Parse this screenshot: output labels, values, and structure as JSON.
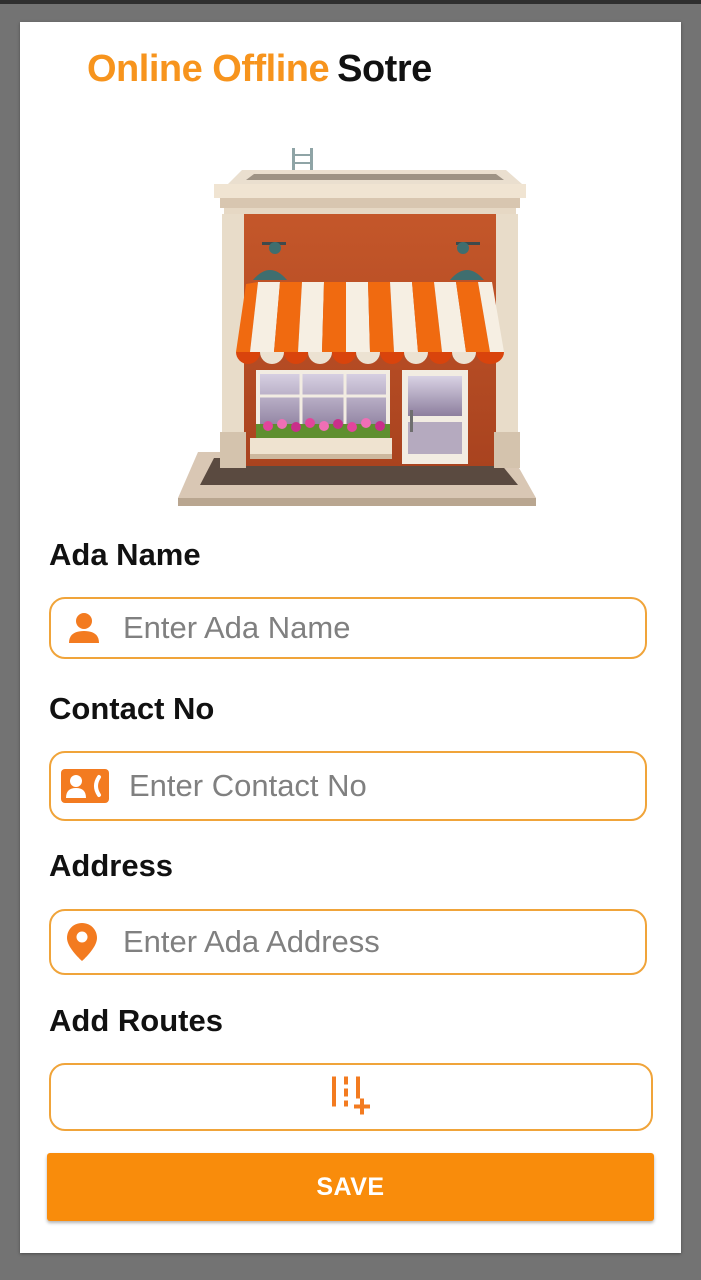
{
  "header": {
    "title_accent": "Online Offline",
    "title_rest": "Sotre"
  },
  "form": {
    "ada_name": {
      "label": "Ada Name",
      "placeholder": "Enter Ada Name",
      "icon": "person-icon"
    },
    "contact": {
      "label": "Contact No",
      "placeholder": "Enter Contact No",
      "icon": "contact-card-icon"
    },
    "address": {
      "label": "Address",
      "placeholder": "Enter Ada Address",
      "icon": "location-pin-icon"
    },
    "routes": {
      "label": "Add Routes",
      "icon": "add-route-icon"
    },
    "save_label": "SAVE"
  },
  "colors": {
    "accent": "#f7941d",
    "button": "#f98c0b",
    "field_border": "#f0a43a",
    "backdrop": "#737373"
  }
}
